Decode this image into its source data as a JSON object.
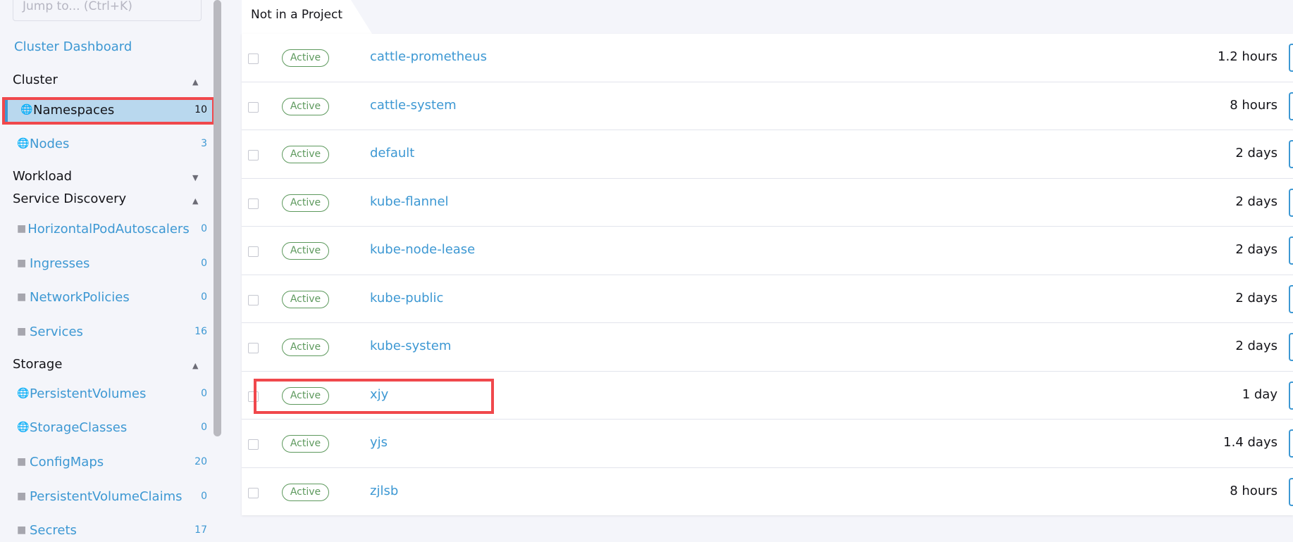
{
  "sidebar": {
    "jump_placeholder": "Jump to... (Ctrl+K)",
    "dashboard_link": "Cluster Dashboard",
    "groups": {
      "cluster": "Cluster",
      "workload": "Workload",
      "service_discovery": "Service Discovery",
      "storage": "Storage"
    },
    "items": {
      "namespaces": {
        "label": "Namespaces",
        "count": "10",
        "icon": "globe-icon"
      },
      "nodes": {
        "label": "Nodes",
        "count": "3",
        "icon": "globe-icon"
      },
      "hpa": {
        "label": "HorizontalPodAutoscalers",
        "count": "0",
        "icon": "folder-icon"
      },
      "ingresses": {
        "label": "Ingresses",
        "count": "0",
        "icon": "folder-icon"
      },
      "network_policies": {
        "label": "NetworkPolicies",
        "count": "0",
        "icon": "folder-icon"
      },
      "services": {
        "label": "Services",
        "count": "16",
        "icon": "folder-icon"
      },
      "persistent_volumes": {
        "label": "PersistentVolumes",
        "count": "0",
        "icon": "globe-icon"
      },
      "storage_classes": {
        "label": "StorageClasses",
        "count": "0",
        "icon": "globe-icon"
      },
      "config_maps": {
        "label": "ConfigMaps",
        "count": "20",
        "icon": "folder-icon"
      },
      "pvcs": {
        "label": "PersistentVolumeClaims",
        "count": "0",
        "icon": "folder-icon"
      },
      "secrets": {
        "label": "Secrets",
        "count": "17",
        "icon": "folder-icon"
      }
    }
  },
  "main": {
    "group_tab": "Not in a Project",
    "rows": [
      {
        "state": "Active",
        "name": "cattle-prometheus",
        "age": "1.2 hours"
      },
      {
        "state": "Active",
        "name": "cattle-system",
        "age": "8 hours"
      },
      {
        "state": "Active",
        "name": "default",
        "age": "2 days"
      },
      {
        "state": "Active",
        "name": "kube-flannel",
        "age": "2 days"
      },
      {
        "state": "Active",
        "name": "kube-node-lease",
        "age": "2 days"
      },
      {
        "state": "Active",
        "name": "kube-public",
        "age": "2 days"
      },
      {
        "state": "Active",
        "name": "kube-system",
        "age": "2 days"
      },
      {
        "state": "Active",
        "name": "xjy",
        "age": "1 day"
      },
      {
        "state": "Active",
        "name": "yjs",
        "age": "1.4 days"
      },
      {
        "state": "Active",
        "name": "zjlsb",
        "age": "8 hours"
      }
    ]
  },
  "colors": {
    "accent": "#3d98d3",
    "active_green": "#5d995d",
    "highlight_red": "#f0484c",
    "selected_bg": "#b9d8ee"
  }
}
